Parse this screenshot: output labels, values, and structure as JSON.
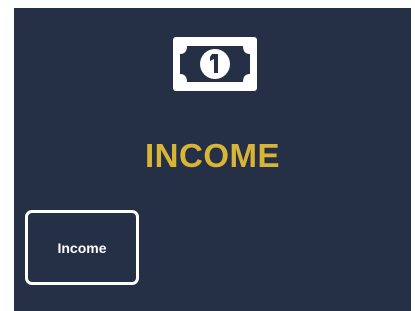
{
  "header": {
    "icon": "dollar-bill-icon",
    "title": "INCOME"
  },
  "buttons": {
    "income_label": "Income"
  },
  "colors": {
    "background": "#253047",
    "title": "#D9B535",
    "icon": "#FFFFFF",
    "button_border": "#FFFFFF"
  }
}
